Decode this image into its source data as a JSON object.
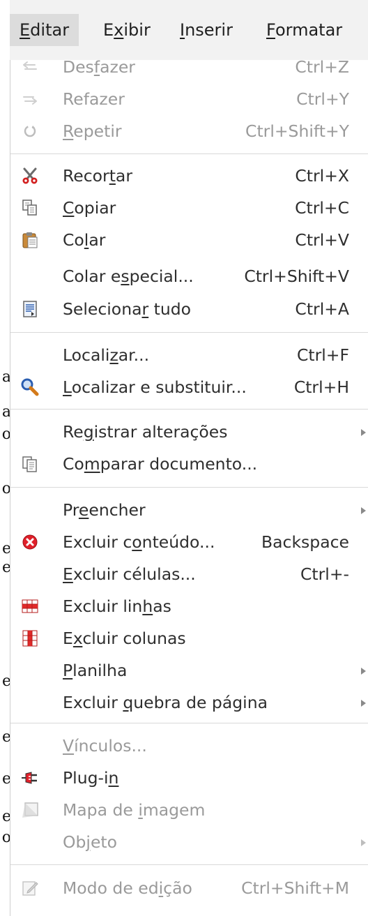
{
  "menubar": {
    "items": [
      {
        "pre": "",
        "mn": "E",
        "post": "ditar"
      },
      {
        "pre": "E",
        "mn": "x",
        "post": "ibir"
      },
      {
        "pre": "",
        "mn": "I",
        "post": "nserir"
      },
      {
        "pre": "",
        "mn": "F",
        "post": "ormatar"
      }
    ]
  },
  "background_text": [
    "a",
    "a",
    "o",
    "o",
    "e",
    "e",
    "e",
    "e",
    "e",
    "e",
    "o"
  ],
  "menu": {
    "undo": {
      "pre": "Des",
      "mn": "f",
      "post": "azer",
      "accel": "Ctrl+Z"
    },
    "redo": {
      "pre": "Refazer",
      "mn": "",
      "post": "",
      "accel": "Ctrl+Y"
    },
    "repeat": {
      "pre": "",
      "mn": "R",
      "post": "epetir",
      "accel": "Ctrl+Shift+Y"
    },
    "cut": {
      "pre": "Recor",
      "mn": "t",
      "post": "ar",
      "accel": "Ctrl+X"
    },
    "copy": {
      "pre": "",
      "mn": "C",
      "post": "opiar",
      "accel": "Ctrl+C"
    },
    "paste": {
      "pre": "Co",
      "mn": "l",
      "post": "ar",
      "accel": "Ctrl+V"
    },
    "paste_special": {
      "pre": "Colar e",
      "mn": "s",
      "post": "pecial...",
      "accel": "Ctrl+Shift+V"
    },
    "select_all": {
      "pre": "Seleciona",
      "mn": "r",
      "post": " tudo",
      "accel": "Ctrl+A"
    },
    "find": {
      "pre": "Locali",
      "mn": "z",
      "post": "ar...",
      "accel": "Ctrl+F"
    },
    "find_replace": {
      "pre": "",
      "mn": "L",
      "post": "ocalizar e substituir...",
      "accel": "Ctrl+H"
    },
    "track_changes": {
      "pre": "Re",
      "mn": "g",
      "post": "istrar alterações"
    },
    "compare": {
      "pre": "Co",
      "mn": "m",
      "post": "parar documento..."
    },
    "fill": {
      "pre": "Pr",
      "mn": "e",
      "post": "encher"
    },
    "delete_contents": {
      "pre": "Excluir c",
      "mn": "o",
      "post": "nteúdo...",
      "accel": "Backspace"
    },
    "delete_cells": {
      "pre": "",
      "mn": "E",
      "post": "xcluir células...",
      "accel": "Ctrl+-"
    },
    "delete_rows": {
      "pre": "Excluir lin",
      "mn": "h",
      "post": "as"
    },
    "delete_columns": {
      "pre": "E",
      "mn": "x",
      "post": "cluir colunas"
    },
    "sheet": {
      "pre": "",
      "mn": "P",
      "post": "lanilha"
    },
    "delete_page_break": {
      "pre": "Excluir ",
      "mn": "q",
      "post": "uebra de página"
    },
    "links": {
      "pre": "",
      "mn": "V",
      "post": "ínculos..."
    },
    "plugin": {
      "pre": "Plug-i",
      "mn": "n",
      "post": ""
    },
    "image_map": {
      "pre": "Mapa de ",
      "mn": "i",
      "post": "magem"
    },
    "object": {
      "pre": "Ob",
      "mn": "j",
      "post": "eto"
    },
    "edit_mode": {
      "pre": "Modo de ed",
      "mn": "i",
      "post": "ção",
      "accel": "Ctrl+Shift+M"
    }
  },
  "colors": {
    "menubar_bg": "#f2f2f2",
    "active_bg": "#dcdcdc",
    "text": "#2e2e2e",
    "disabled": "#9a9a9a",
    "separator": "#d9d9d9"
  }
}
